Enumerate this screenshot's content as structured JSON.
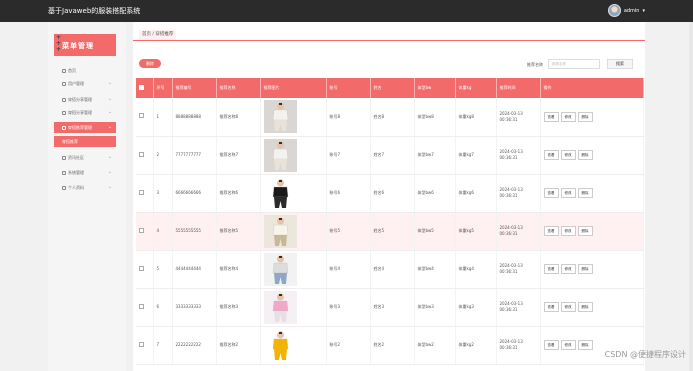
{
  "app": {
    "title": "基于Javaweb的服装搭配系统",
    "user": "admin"
  },
  "sidebar": {
    "header": "菜单管理",
    "items": [
      {
        "label": "首页",
        "icon": "home-icon",
        "state": "normal"
      },
      {
        "label": "用户管理",
        "icon": "user-icon",
        "state": "normal"
      },
      {
        "label": "穿搭分享管理",
        "icon": "share-icon",
        "state": "normal"
      },
      {
        "label": "穿搭分享管理",
        "icon": "share-icon",
        "state": "normal"
      },
      {
        "label": "穿搭推荐管理",
        "icon": "flag-icon",
        "state": "active"
      },
      {
        "label": "穿搭推荐",
        "icon": "",
        "state": "sub"
      },
      {
        "label": "资讯社区",
        "icon": "grid-icon",
        "state": "normal"
      },
      {
        "label": "系统管理",
        "icon": "gear-icon",
        "state": "normal"
      },
      {
        "label": "个人资料",
        "icon": "folder-icon",
        "state": "normal"
      }
    ]
  },
  "breadcrumb": {
    "home": "首页",
    "sep": " / ",
    "current": "穿搭推荐"
  },
  "toolbar": {
    "delete_label": "删除",
    "search_label": "推荐名称",
    "search_placeholder": "推荐名称",
    "search_button": "搜索"
  },
  "table": {
    "headers": [
      "",
      "序号",
      "推荐编号",
      "推荐名称",
      "推荐图片",
      "账号",
      "姓名",
      "体型bw",
      "体重kg",
      "推荐时间",
      "操作"
    ],
    "rows": [
      {
        "idx": "1",
        "code": "8888888888",
        "name": "推荐名称8",
        "account": "账号8",
        "person": "姓名8",
        "bw": "体型bw8",
        "kg": "体重kg8",
        "time": "2024-03-13 00:36:31",
        "img": "lace",
        "hl": false
      },
      {
        "idx": "2",
        "code": "7777777777",
        "name": "推荐名称7",
        "account": "账号7",
        "person": "姓名7",
        "bw": "体型bw7",
        "kg": "体重kg7",
        "time": "2024-03-13 00:36:31",
        "img": "lace",
        "hl": false
      },
      {
        "idx": "3",
        "code": "6666666666",
        "name": "推荐名称6",
        "account": "账号6",
        "person": "姓名6",
        "bw": "体型bw6",
        "kg": "体重kg6",
        "time": "2024-03-13 00:36:31",
        "img": "black",
        "hl": false
      },
      {
        "idx": "4",
        "code": "5555555555",
        "name": "推荐名称5",
        "account": "账号5",
        "person": "姓名5",
        "bw": "体型bw5",
        "kg": "体重kg5",
        "time": "2024-03-13 00:36:31",
        "img": "beige",
        "hl": true
      },
      {
        "idx": "5",
        "code": "4444444444",
        "name": "推荐名称4",
        "account": "账号4",
        "person": "姓名4",
        "bw": "体型bw4",
        "kg": "体重kg4",
        "time": "2024-03-13 00:36:31",
        "img": "grey",
        "hl": false
      },
      {
        "idx": "6",
        "code": "3333333333",
        "name": "推荐名称3",
        "account": "账号3",
        "person": "姓名3",
        "bw": "体型bw3",
        "kg": "体重kg3",
        "time": "2024-03-13 00:36:31",
        "img": "pink",
        "hl": false
      },
      {
        "idx": "7",
        "code": "2222222222",
        "name": "推荐名称2",
        "account": "账号2",
        "person": "姓名2",
        "bw": "体型bw2",
        "kg": "体重kg2",
        "time": "2024-03-13 00:36:31",
        "img": "yellow",
        "hl": false
      }
    ],
    "ops": [
      "查看",
      "修改",
      "删除"
    ]
  },
  "watermark": "CSDN @便捷程序设计",
  "colors": {
    "accent": "#f36a6a",
    "topbar": "#2b2b2b",
    "highlight_row": "#fff1f1"
  }
}
